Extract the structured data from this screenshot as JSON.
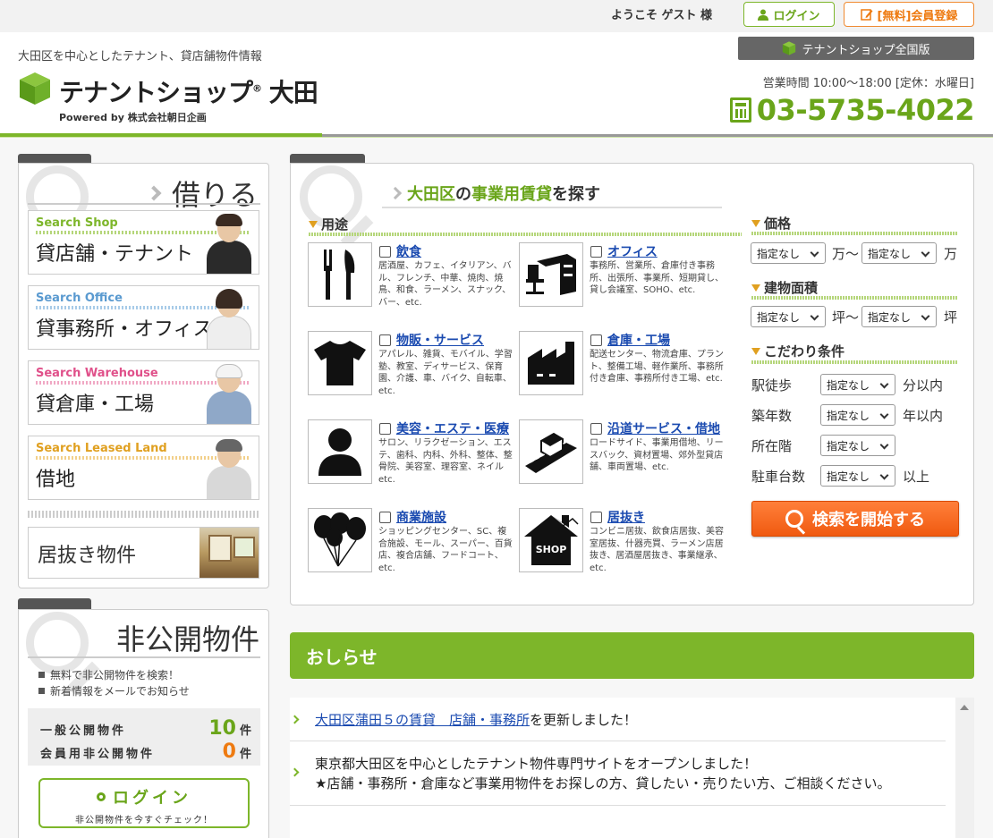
{
  "header": {
    "welcome": "ようこそ ゲスト 様",
    "login_label": "ログイン",
    "register_label": "[無料]会員登録",
    "tagline": "大田区を中心としたテナント、貸店舗物件情報",
    "logo_text": "テナントショップ",
    "logo_reg": "®",
    "logo_city": "大田",
    "logo_sub": "Powered by 株式会社朝日企画",
    "national_label": "テナントショップ全国版",
    "hours": "営業時間 10:00〜18:00 [定休：水曜日]",
    "phone": "03-5735-4022",
    "accent_color": "#7db62a"
  },
  "rent_panel": {
    "title": "借りる",
    "categories": [
      {
        "en": "Search Shop",
        "jp": "貸店舗・テナント",
        "color": "#7db62a"
      },
      {
        "en": "Search Office",
        "jp": "貸事務所・オフィス",
        "color": "#5a9ad0"
      },
      {
        "en": "Search Warehouse",
        "jp": "貸倉庫・工場",
        "color": "#e0508a"
      },
      {
        "en": "Search Leased Land",
        "jp": "借地",
        "color": "#e0a020"
      }
    ],
    "inuki_label": "居抜き物件"
  },
  "private_panel": {
    "title": "非公開物件",
    "bullets": [
      "無料で非公開物件を検索！",
      "新着情報をメールでお知らせ"
    ],
    "public_label": "一般公開物件",
    "public_count": "10",
    "member_label": "会員用非公開物件",
    "member_count": "0",
    "unit": "件",
    "login_label": "ログイン",
    "login_sub": "非公開物件を今すぐチェック！"
  },
  "search": {
    "title_a": "大田区",
    "title_b": "の",
    "title_c": "事業用賃貸",
    "title_d": "を探す",
    "use_label": "用途",
    "uses": [
      {
        "name": "飲食",
        "desc": "居酒屋、カフェ、イタリアン、バル、フレンチ、中華、焼肉、焼鳥、和食、ラーメン、スナック、バー、etc.",
        "icon": "cutlery-icon"
      },
      {
        "name": "オフィス",
        "desc": "事務所、営業所、倉庫付き事務所、出張所、事業所、短期貸し、貸し会議室、SOHO、etc.",
        "icon": "desk-icon"
      },
      {
        "name": "物販・サービス",
        "desc": "アパレル、雑貨、モバイル、学習塾、教室、ディサービス、保育園、介護、車、バイク、自転車、etc.",
        "icon": "tshirt-icon"
      },
      {
        "name": "倉庫・工場",
        "desc": "配送センター、物流倉庫、プラント、整備工場、軽作業所、事務所付き倉庫、事務所付き工場、etc.",
        "icon": "factory-icon"
      },
      {
        "name": "美容・エステ・医療",
        "desc": "サロン、リラクゼーション、エステ、歯科、内科、外科、整体、整骨院、美容室、理容室、ネイル etc.",
        "icon": "person-icon"
      },
      {
        "name": "沿道サービス・借地",
        "desc": "ロードサイド、事業用借地、リースバック、資材置場、郊外型貸店舗、車両置場、etc.",
        "icon": "road-icon"
      },
      {
        "name": "商業施設",
        "desc": "ショッピングセンター、SC、複合施設、モール、スーパー、百貨店、複合店舗、フードコート、etc.",
        "icon": "balloons-icon"
      },
      {
        "name": "居抜き",
        "desc": "コンビニ居抜、飲食店居抜、美容室居抜、什器売買、ラーメン店居抜き、居酒屋居抜き、事業継承、etc.",
        "icon": "shop-house-icon"
      }
    ],
    "price_label": "価格",
    "area_label": "建物面積",
    "cond_label": "こだわり条件",
    "not_specified": "指定なし",
    "price_unit_mid": "万〜",
    "price_unit_end": "万",
    "area_unit_mid": "坪〜",
    "area_unit_end": "坪",
    "conditions": [
      {
        "label": "駅徒歩",
        "unit": "分以内"
      },
      {
        "label": "築年数",
        "unit": "年以内"
      },
      {
        "label": "所在階",
        "unit": ""
      },
      {
        "label": "駐車台数",
        "unit": "以上"
      }
    ],
    "search_button": "検索を開始する"
  },
  "news": {
    "title": "おしらせ",
    "items": [
      {
        "link": "大田区蒲田５の賃貸　店舗・事務所",
        "text": "を更新しました！"
      },
      {
        "line1": "東京都大田区を中心としたテナント物件専門サイトをオープンしました！",
        "line2": "★店舗・事務所・倉庫など事業用物件をお探しの方、貸したい・売りたい方、ご相談ください。"
      }
    ]
  }
}
